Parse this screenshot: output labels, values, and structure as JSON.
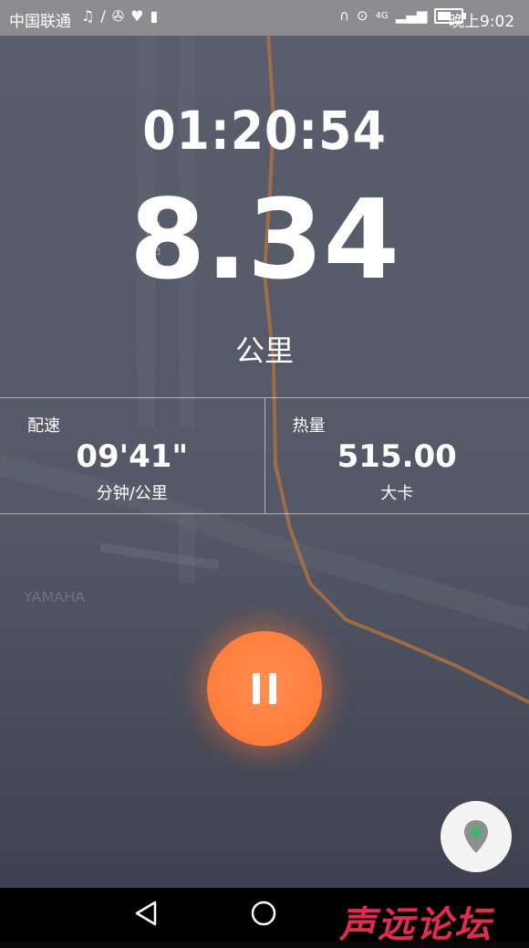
{
  "status_bar": {
    "carrier": "中国联通",
    "time": "晚上9:02",
    "network": "4G",
    "icons_left": [
      "music-icon",
      "signal-icon",
      "running-icon",
      "heart-icon",
      "battery-small-icon"
    ],
    "icons_right": [
      "headphones-icon",
      "location-icon",
      "signal-bars-icon",
      "battery-icon"
    ]
  },
  "map": {
    "road_label": "海川路",
    "place_label": "YAMAHA"
  },
  "workout": {
    "elapsed_time": "01:20:54",
    "distance": "8.34",
    "distance_unit": "公里",
    "pace": {
      "label": "配速",
      "value": "09'41\"",
      "unit": "分钟/公里"
    },
    "calories": {
      "label": "热量",
      "value": "515.00",
      "unit": "大卡"
    }
  },
  "controls": {
    "pause_icon": "pause-icon",
    "locate_icon": "location-pin-icon"
  },
  "nav_bar": {
    "icons": [
      "back-triangle-icon",
      "home-circle-icon"
    ],
    "watermark": "声远论坛"
  },
  "colors": {
    "accent": "#ff7f3e",
    "route": "#b5743d",
    "status_bar": "#8d8d8f",
    "locate_dot": "#3db56a",
    "watermark": "#e32a4f"
  }
}
